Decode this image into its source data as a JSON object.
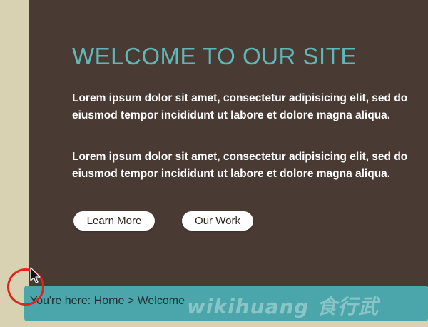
{
  "welcome": {
    "title": "WELCOME TO OUR SITE",
    "paragraphs": [
      {
        "line1": "Lorem ipsum dolor sit amet, consectetur adipisicing elit, sed do",
        "line2": "eiusmod tempor incididunt ut labore et dolore magna aliqua."
      },
      {
        "line1": "Lorem ipsum dolor sit amet, consectetur adipisicing elit, sed do",
        "line2": "eiusmod tempor incididunt ut labore et dolore magna aliqua."
      }
    ],
    "buttons": {
      "learn_more": "Learn More",
      "our_work": "Our Work"
    }
  },
  "breadcrumb": {
    "prefix": "You're here:",
    "home": "Home",
    "separator": ">",
    "current": "Welcome"
  },
  "watermark": "wikihuang 食行武",
  "colors": {
    "panel_background": "#4a3a34",
    "title_accent": "#5fb8b8",
    "footer_bar": "#4aa6aa",
    "page_background": "#d8d2b3",
    "cursor_highlight": "#e2231a"
  }
}
